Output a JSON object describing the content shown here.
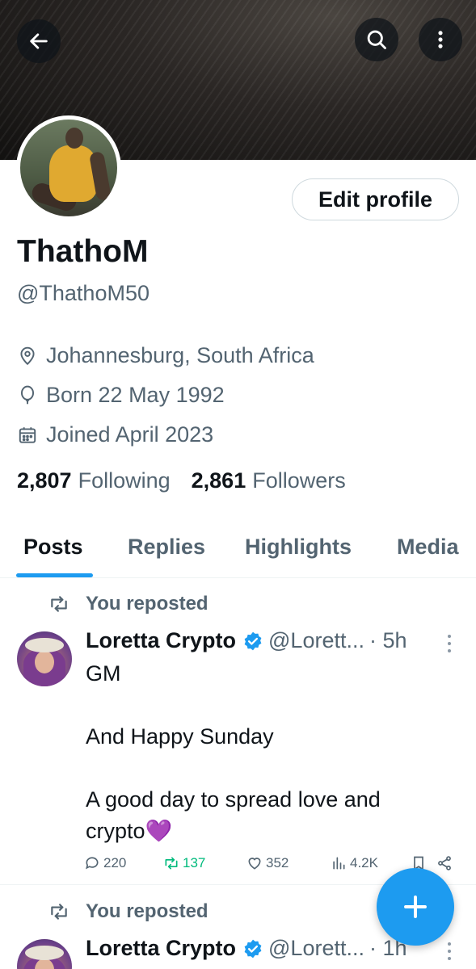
{
  "header": {
    "back_icon": "arrow-left-icon",
    "search_icon": "search-icon",
    "more_icon": "more-vertical-icon"
  },
  "profile": {
    "name": "ThathoM",
    "handle": "@ThathoM50",
    "edit_label": "Edit profile",
    "location": "Johannesburg, South Africa",
    "born": "Born 22 May 1992",
    "joined": "Joined April 2023",
    "following_count": "2,807",
    "following_label": "Following",
    "followers_count": "2,861",
    "followers_label": "Followers"
  },
  "tabs": [
    {
      "label": "Posts",
      "active": true
    },
    {
      "label": "Replies",
      "active": false
    },
    {
      "label": "Highlights",
      "active": false
    },
    {
      "label": "Media",
      "active": false
    }
  ],
  "posts": [
    {
      "repost_label": "You reposted",
      "author": "Loretta Crypto",
      "handle": "@Lorett...",
      "time": "· 5h",
      "body": [
        "GM",
        "",
        "And Happy Sunday",
        "",
        "A good day to spread love and",
        "crypto💜"
      ],
      "replies": "220",
      "reposts": "137",
      "likes": "352",
      "views": "4.2K"
    },
    {
      "repost_label": "You reposted",
      "author": "Loretta Crypto",
      "handle": "@Lorett...",
      "time": "· 1h"
    }
  ],
  "colors": {
    "accent": "#1d9bf0",
    "repost_green": "#00ba7c",
    "text_primary": "#0f1419",
    "text_secondary": "#536471"
  },
  "fab_icon": "plus-icon"
}
